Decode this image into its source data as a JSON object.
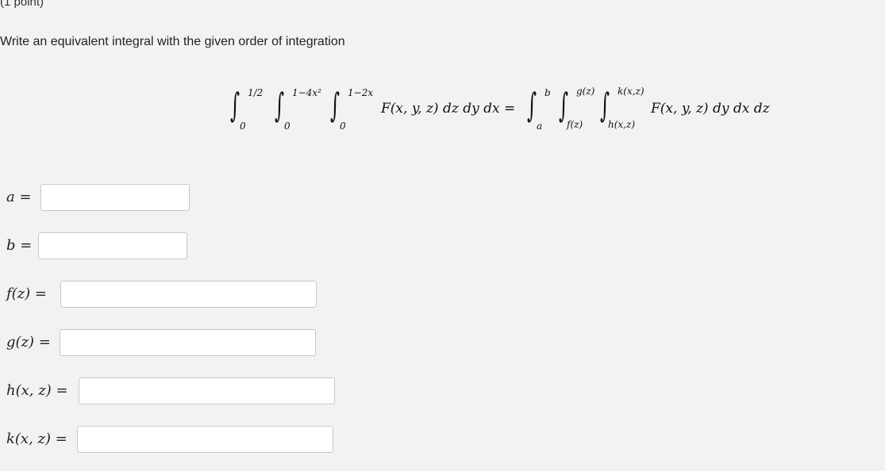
{
  "problem": {
    "points": "(1 point)",
    "instructions": "Write an equivalent integral with the given order of integration"
  },
  "equation": {
    "lhs": {
      "outer_upper": "1/2",
      "outer_lower": "0",
      "middle_upper": "1−4x²",
      "middle_lower": "0",
      "inner_upper": "1−2x",
      "inner_lower": "0",
      "integrand": "F(x, y, z) dz dy dx ="
    },
    "rhs": {
      "outer_upper": "b",
      "outer_lower": "a",
      "middle_upper": "g(z)",
      "middle_lower": "f(z)",
      "inner_upper": "k(x,z)",
      "inner_lower": "h(x,z)",
      "integrand": "F(x, y, z) dy dx dz"
    }
  },
  "answers": [
    {
      "label": "a =",
      "value": "",
      "placeholder": ""
    },
    {
      "label": "b =",
      "value": "",
      "placeholder": ""
    },
    {
      "label": "f(z) =",
      "value": "",
      "placeholder": ""
    },
    {
      "label": "g(z) =",
      "value": "",
      "placeholder": ""
    },
    {
      "label": "h(x, z) =",
      "value": "",
      "placeholder": ""
    },
    {
      "label": "k(x, z) =",
      "value": "",
      "placeholder": ""
    }
  ]
}
